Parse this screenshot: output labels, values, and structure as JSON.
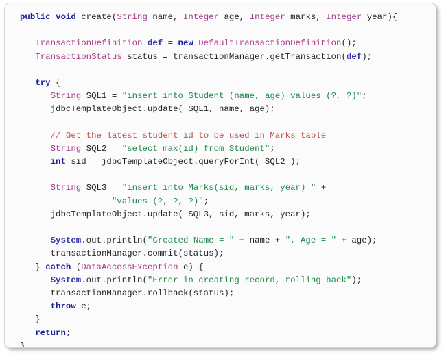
{
  "figure": {
    "kind": "code-snippet-image",
    "language": "java",
    "background_color": "#fbfbfb",
    "border_color": "#d8d8d8"
  },
  "theme": {
    "keyword_color": "#1f1f9e",
    "type_color": "#a63c8c",
    "string_color": "#1f8a4c",
    "comment_color": "#b8514f",
    "variable_color": "#3333aa",
    "plain_color": "#262626"
  },
  "code": {
    "lines": [
      {
        "n": 1,
        "text": "public void create(String name, Integer age, Integer marks, Integer year){",
        "tokens": [
          {
            "t": "public",
            "c": "kw"
          },
          {
            "t": " ",
            "c": "pln"
          },
          {
            "t": "void",
            "c": "kw"
          },
          {
            "t": " create(",
            "c": "pln"
          },
          {
            "t": "String",
            "c": "typ"
          },
          {
            "t": " name, ",
            "c": "pln"
          },
          {
            "t": "Integer",
            "c": "typ"
          },
          {
            "t": " age, ",
            "c": "pln"
          },
          {
            "t": "Integer",
            "c": "typ"
          },
          {
            "t": " marks, ",
            "c": "pln"
          },
          {
            "t": "Integer",
            "c": "typ"
          },
          {
            "t": " year){",
            "c": "pln"
          }
        ]
      },
      {
        "n": 2,
        "text": "",
        "tokens": []
      },
      {
        "n": 3,
        "text": "   TransactionDefinition def = new DefaultTransactionDefinition();",
        "tokens": [
          {
            "t": "   ",
            "c": "pln"
          },
          {
            "t": "TransactionDefinition",
            "c": "typ"
          },
          {
            "t": " ",
            "c": "pln"
          },
          {
            "t": "def",
            "c": "var"
          },
          {
            "t": " = ",
            "c": "pln"
          },
          {
            "t": "new",
            "c": "kw"
          },
          {
            "t": " ",
            "c": "pln"
          },
          {
            "t": "DefaultTransactionDefinition",
            "c": "typ"
          },
          {
            "t": "();",
            "c": "pln"
          }
        ]
      },
      {
        "n": 4,
        "text": "   TransactionStatus status = transactionManager.getTransaction(def);",
        "tokens": [
          {
            "t": "   ",
            "c": "pln"
          },
          {
            "t": "TransactionStatus",
            "c": "typ"
          },
          {
            "t": " status = transactionManager.getTransaction(",
            "c": "pln"
          },
          {
            "t": "def",
            "c": "var"
          },
          {
            "t": ");",
            "c": "pln"
          }
        ]
      },
      {
        "n": 5,
        "text": "",
        "tokens": []
      },
      {
        "n": 6,
        "text": "   try {",
        "tokens": [
          {
            "t": "   ",
            "c": "pln"
          },
          {
            "t": "try",
            "c": "kw"
          },
          {
            "t": " {",
            "c": "pln"
          }
        ]
      },
      {
        "n": 7,
        "text": "      String SQL1 = \"insert into Student (name, age) values (?, ?)\";",
        "tokens": [
          {
            "t": "      ",
            "c": "pln"
          },
          {
            "t": "String",
            "c": "typ"
          },
          {
            "t": " SQL1 = ",
            "c": "pln"
          },
          {
            "t": "\"insert into Student (name, age) values (?, ?)\"",
            "c": "str"
          },
          {
            "t": ";",
            "c": "pln"
          }
        ]
      },
      {
        "n": 8,
        "text": "      jdbcTemplateObject.update( SQL1, name, age);",
        "tokens": [
          {
            "t": "      jdbcTemplateObject.update( SQL1, name, age);",
            "c": "pln"
          }
        ]
      },
      {
        "n": 9,
        "text": "",
        "tokens": []
      },
      {
        "n": 10,
        "text": "      // Get the latest student id to be used in Marks table",
        "tokens": [
          {
            "t": "      ",
            "c": "pln"
          },
          {
            "t": "// Get the latest student id to be used in Marks table",
            "c": "cmt"
          }
        ]
      },
      {
        "n": 11,
        "text": "      String SQL2 = \"select max(id) from Student\";",
        "tokens": [
          {
            "t": "      ",
            "c": "pln"
          },
          {
            "t": "String",
            "c": "typ"
          },
          {
            "t": " SQL2 = ",
            "c": "pln"
          },
          {
            "t": "\"select max(id) from Student\"",
            "c": "str"
          },
          {
            "t": ";",
            "c": "pln"
          }
        ]
      },
      {
        "n": 12,
        "text": "      int sid = jdbcTemplateObject.queryForInt( SQL2 );",
        "tokens": [
          {
            "t": "      ",
            "c": "pln"
          },
          {
            "t": "int",
            "c": "kw"
          },
          {
            "t": " sid = jdbcTemplateObject.queryForInt( SQL2 );",
            "c": "pln"
          }
        ]
      },
      {
        "n": 13,
        "text": "",
        "tokens": []
      },
      {
        "n": 14,
        "text": "      String SQL3 = \"insert into Marks(sid, marks, year) \" +",
        "tokens": [
          {
            "t": "      ",
            "c": "pln"
          },
          {
            "t": "String",
            "c": "typ"
          },
          {
            "t": " SQL3 = ",
            "c": "pln"
          },
          {
            "t": "\"insert into Marks(sid, marks, year) \"",
            "c": "str"
          },
          {
            "t": " +",
            "c": "pln"
          }
        ]
      },
      {
        "n": 15,
        "text": "                  \"values (?, ?, ?)\";",
        "tokens": [
          {
            "t": "                  ",
            "c": "pln"
          },
          {
            "t": "\"values (?, ?, ?)\"",
            "c": "str"
          },
          {
            "t": ";",
            "c": "pln"
          }
        ]
      },
      {
        "n": 16,
        "text": "      jdbcTemplateObject.update( SQL3, sid, marks, year);",
        "tokens": [
          {
            "t": "      jdbcTemplateObject.update( SQL3, sid, marks, year);",
            "c": "pln"
          }
        ]
      },
      {
        "n": 17,
        "text": "",
        "tokens": []
      },
      {
        "n": 18,
        "text": "      System.out.println(\"Created Name = \" + name + \", Age = \" + age);",
        "tokens": [
          {
            "t": "      ",
            "c": "pln"
          },
          {
            "t": "System",
            "c": "var"
          },
          {
            "t": ".out.println(",
            "c": "pln"
          },
          {
            "t": "\"Created Name = \"",
            "c": "str"
          },
          {
            "t": " + name + ",
            "c": "pln"
          },
          {
            "t": "\", Age = \"",
            "c": "str"
          },
          {
            "t": " + age);",
            "c": "pln"
          }
        ]
      },
      {
        "n": 19,
        "text": "      transactionManager.commit(status);",
        "tokens": [
          {
            "t": "      transactionManager.commit(status);",
            "c": "pln"
          }
        ]
      },
      {
        "n": 20,
        "text": "   } catch (DataAccessException e) {",
        "tokens": [
          {
            "t": "   } ",
            "c": "pln"
          },
          {
            "t": "catch",
            "c": "kw"
          },
          {
            "t": " (",
            "c": "pln"
          },
          {
            "t": "DataAccessException",
            "c": "typ"
          },
          {
            "t": " e) {",
            "c": "pln"
          }
        ]
      },
      {
        "n": 21,
        "text": "      System.out.println(\"Error in creating record, rolling back\");",
        "tokens": [
          {
            "t": "      ",
            "c": "pln"
          },
          {
            "t": "System",
            "c": "var"
          },
          {
            "t": ".out.println(",
            "c": "pln"
          },
          {
            "t": "\"Error in creating record, rolling back\"",
            "c": "str"
          },
          {
            "t": ");",
            "c": "pln"
          }
        ]
      },
      {
        "n": 22,
        "text": "      transactionManager.rollback(status);",
        "tokens": [
          {
            "t": "      transactionManager.rollback(status);",
            "c": "pln"
          }
        ]
      },
      {
        "n": 23,
        "text": "      throw e;",
        "tokens": [
          {
            "t": "      ",
            "c": "pln"
          },
          {
            "t": "throw",
            "c": "kw"
          },
          {
            "t": " e;",
            "c": "pln"
          }
        ]
      },
      {
        "n": 24,
        "text": "   }",
        "tokens": [
          {
            "t": "   }",
            "c": "pln"
          }
        ]
      },
      {
        "n": 25,
        "text": "   return;",
        "tokens": [
          {
            "t": "   ",
            "c": "pln"
          },
          {
            "t": "return",
            "c": "kw"
          },
          {
            "t": ";",
            "c": "pln"
          }
        ]
      },
      {
        "n": 26,
        "text": "}",
        "tokens": [
          {
            "t": "}",
            "c": "pln"
          }
        ]
      }
    ]
  }
}
